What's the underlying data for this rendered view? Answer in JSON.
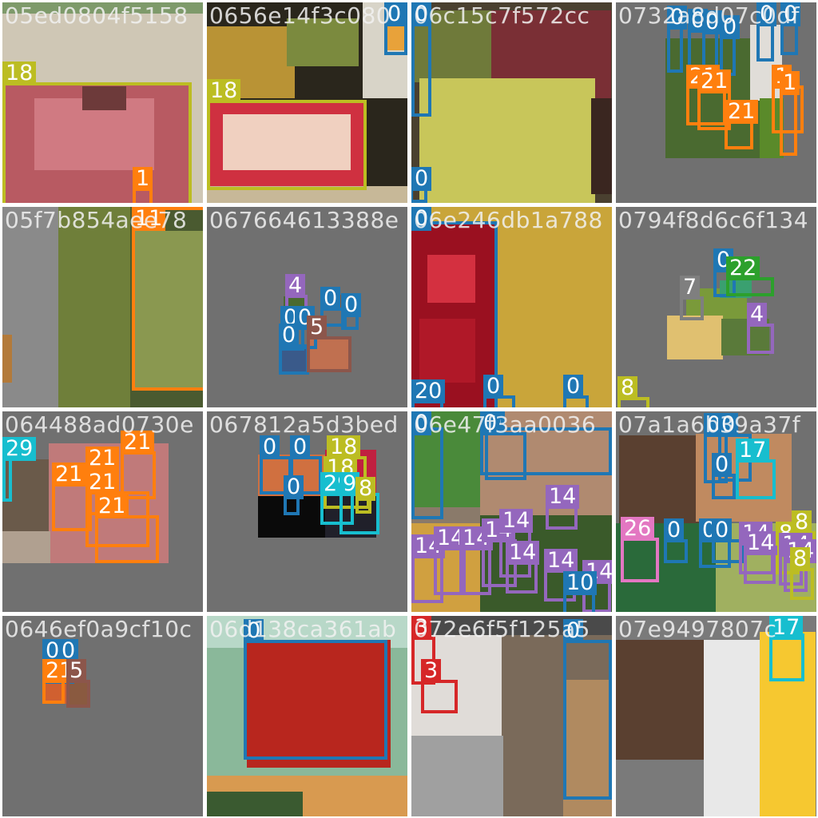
{
  "palette": {
    "0": "#1f77b4",
    "1": "#ff7f0e",
    "3": "#d62728",
    "4": "#9467bd",
    "5": "#8c564b",
    "7": "#7f7f7f",
    "8": "#bcbd22",
    "9": "#17becf",
    "10": "#1f77b4",
    "11": "#ff7f0e",
    "14": "#9467bd",
    "17": "#17becf",
    "18": "#bcbd22",
    "20": "#1f77b4",
    "21": "#ff7f0e",
    "22": "#2ca02c",
    "26": "#e377c2",
    "29": "#17becf"
  },
  "tiles": [
    {
      "id": "05ed0804f5158",
      "pieces": [
        [
          "#cfc7b5",
          0,
          0,
          251,
          251
        ],
        [
          "#7e9a6a",
          0,
          0,
          251,
          14
        ],
        [
          "#b85a62",
          0,
          102,
          235,
          149
        ],
        [
          "#d07a82",
          40,
          120,
          150,
          90
        ],
        [
          "#6d3a3a",
          100,
          105,
          55,
          30
        ]
      ],
      "boxes": [
        [
          0,
          100,
          237,
          155,
          "18"
        ],
        [
          163,
          232,
          25,
          25,
          "1"
        ]
      ]
    },
    {
      "id": "0656e14f3c080",
      "pieces": [
        [
          "#2a261c",
          0,
          0,
          251,
          251
        ],
        [
          "#b99335",
          0,
          30,
          110,
          90
        ],
        [
          "#7b8a3e",
          100,
          20,
          90,
          60
        ],
        [
          "#d8d4c8",
          195,
          0,
          56,
          120
        ],
        [
          "#e8a23a",
          225,
          30,
          22,
          30
        ],
        [
          "#cf3040",
          0,
          122,
          200,
          110
        ],
        [
          "#f0d0c0",
          20,
          140,
          160,
          70
        ],
        [
          "#c7b898",
          0,
          230,
          251,
          21
        ]
      ],
      "boxes": [
        [
          0,
          122,
          200,
          113,
          "18"
        ],
        [
          222,
          0,
          29,
          66,
          "0"
        ]
      ]
    },
    {
      "id": "06c15c7f572cc",
      "pieces": [
        [
          "#4a4030",
          0,
          0,
          251,
          251
        ],
        [
          "#7a2f35",
          100,
          10,
          150,
          120
        ],
        [
          "#6f7a3a",
          0,
          10,
          100,
          90
        ],
        [
          "#c8c65a",
          10,
          95,
          220,
          156
        ],
        [
          "#3a2620",
          225,
          120,
          26,
          120
        ]
      ],
      "boxes": [
        [
          0,
          0,
          25,
          143,
          "0"
        ],
        [
          -2,
          232,
          22,
          19,
          "0"
        ]
      ]
    },
    {
      "id": "0732a8d07c0df",
      "pieces": [
        [
          "#707070",
          0,
          0,
          251,
          251
        ],
        [
          "#4a6a30",
          62,
          45,
          135,
          150
        ],
        [
          "#e0ddd8",
          168,
          28,
          40,
          95
        ],
        [
          "#5a8a2a",
          180,
          120,
          30,
          75
        ]
      ],
      "boxes": [
        [
          64,
          30,
          20,
          58,
          "0"
        ],
        [
          90,
          34,
          22,
          55,
          "0"
        ],
        [
          108,
          36,
          20,
          50,
          "0"
        ],
        [
          130,
          42,
          20,
          50,
          "0"
        ],
        [
          176,
          26,
          22,
          48,
          "0"
        ],
        [
          206,
          26,
          22,
          40,
          "0"
        ],
        [
          88,
          104,
          50,
          50,
          "21"
        ],
        [
          102,
          110,
          42,
          50,
          "21"
        ],
        [
          136,
          148,
          36,
          36,
          "21"
        ],
        [
          195,
          104,
          40,
          60,
          "1"
        ],
        [
          205,
          112,
          22,
          80,
          "1"
        ]
      ]
    },
    {
      "id": "05f7b854aee78",
      "pieces": [
        [
          "#4a5a30",
          0,
          0,
          251,
          251
        ],
        [
          "#8a8a8a",
          0,
          0,
          75,
          251
        ],
        [
          "#6f7f3a",
          70,
          0,
          90,
          251
        ],
        [
          "#8a9850",
          162,
          30,
          89,
          200
        ],
        [
          "#b37a3a",
          0,
          160,
          12,
          60
        ]
      ],
      "boxes": [
        [
          162,
          0,
          93,
          230,
          "11"
        ]
      ]
    },
    {
      "id": "067664613388e",
      "pieces": [
        [
          "#707070",
          0,
          0,
          251,
          251
        ],
        [
          "#4a6a30",
          96,
          112,
          30,
          32
        ],
        [
          "#c07050",
          125,
          162,
          56,
          45
        ],
        [
          "#3a5a8a",
          90,
          172,
          38,
          38
        ],
        [
          "#8a5a3a",
          142,
          110,
          30,
          20
        ]
      ],
      "boxes": [
        [
          98,
          110,
          28,
          34,
          "4"
        ],
        [
          142,
          126,
          33,
          24,
          "0"
        ],
        [
          168,
          134,
          22,
          20,
          "0"
        ],
        [
          92,
          150,
          30,
          30,
          "0"
        ],
        [
          110,
          150,
          28,
          28,
          "0"
        ],
        [
          90,
          172,
          38,
          38,
          "0"
        ],
        [
          125,
          162,
          56,
          45,
          "5"
        ]
      ]
    },
    {
      "id": "06e246db1a788",
      "pieces": [
        [
          "#c9a53a",
          0,
          0,
          251,
          251
        ],
        [
          "#9a1020",
          0,
          20,
          108,
          231
        ],
        [
          "#d43040",
          20,
          60,
          60,
          60
        ],
        [
          "#b01828",
          10,
          140,
          70,
          80
        ]
      ],
      "boxes": [
        [
          -4,
          18,
          112,
          240,
          "0"
        ],
        [
          90,
          236,
          40,
          20,
          "0"
        ],
        [
          190,
          236,
          32,
          20,
          "0"
        ],
        [
          0,
          242,
          40,
          20,
          "20"
        ]
      ]
    },
    {
      "id": "0794f8d6c6f134",
      "pieces": [
        [
          "#707070",
          0,
          0,
          251,
          251
        ],
        [
          "#7a9a3a",
          88,
          102,
          76,
          50
        ],
        [
          "#e0c070",
          64,
          136,
          70,
          55
        ],
        [
          "#5a7a3a",
          132,
          140,
          60,
          46
        ],
        [
          "#3aa070",
          130,
          92,
          40,
          22
        ]
      ],
      "boxes": [
        [
          122,
          78,
          28,
          35,
          "0"
        ],
        [
          138,
          88,
          60,
          24,
          "22"
        ],
        [
          80,
          112,
          30,
          30,
          "7"
        ],
        [
          164,
          146,
          34,
          38,
          "4"
        ],
        [
          2,
          238,
          40,
          30,
          "8"
        ]
      ]
    },
    {
      "id": "064488ad0730e",
      "pieces": [
        [
          "#707070",
          0,
          0,
          251,
          251
        ],
        [
          "#6a5a4a",
          0,
          60,
          60,
          130
        ],
        [
          "#c07a7a",
          58,
          40,
          150,
          150
        ],
        [
          "#b0a090",
          0,
          150,
          60,
          40
        ]
      ],
      "boxes": [
        [
          0,
          58,
          12,
          55,
          "29"
        ],
        [
          62,
          90,
          50,
          60,
          "21"
        ],
        [
          104,
          70,
          42,
          60,
          "21"
        ],
        [
          148,
          50,
          44,
          60,
          "21"
        ],
        [
          104,
          100,
          80,
          70,
          "21"
        ],
        [
          116,
          130,
          80,
          60,
          "21"
        ]
      ]
    },
    {
      "id": "067812a5d3bed",
      "pieces": [
        [
          "#707070",
          0,
          0,
          251,
          251
        ],
        [
          "#d07040",
          64,
          54,
          84,
          52
        ],
        [
          "#0a0a0a",
          64,
          106,
          84,
          52
        ],
        [
          "#c02040",
          148,
          48,
          64,
          58
        ],
        [
          "#20202a",
          148,
          106,
          64,
          52
        ]
      ],
      "boxes": [
        [
          66,
          56,
          40,
          48,
          "0"
        ],
        [
          104,
          56,
          40,
          48,
          "0"
        ],
        [
          150,
          56,
          50,
          50,
          "18"
        ],
        [
          146,
          82,
          58,
          40,
          "18"
        ],
        [
          142,
          102,
          42,
          40,
          "29"
        ],
        [
          166,
          102,
          50,
          52,
          "9"
        ],
        [
          186,
          108,
          20,
          20,
          "8"
        ],
        [
          96,
          106,
          20,
          24,
          "0"
        ]
      ]
    },
    {
      "id": "06e47f3aa0036",
      "pieces": [
        [
          "#8a7a6a",
          0,
          0,
          251,
          251
        ],
        [
          "#4a8a3a",
          0,
          0,
          86,
          120
        ],
        [
          "#b08a70",
          86,
          0,
          165,
          140
        ],
        [
          "#3a5a2a",
          86,
          130,
          165,
          121
        ],
        [
          "#d0a040",
          0,
          140,
          86,
          111
        ]
      ],
      "boxes": [
        [
          0,
          20,
          40,
          115,
          "0"
        ],
        [
          92,
          26,
          52,
          60,
          "0"
        ],
        [
          86,
          20,
          165,
          60,
          "0"
        ],
        [
          168,
          118,
          40,
          30,
          "14"
        ],
        [
          0,
          180,
          40,
          60,
          "14"
        ],
        [
          28,
          170,
          40,
          60,
          "14"
        ],
        [
          60,
          170,
          40,
          60,
          "14"
        ],
        [
          88,
          160,
          44,
          60,
          "14"
        ],
        [
          110,
          148,
          40,
          60,
          "14"
        ],
        [
          118,
          188,
          40,
          40,
          "14"
        ],
        [
          166,
          198,
          40,
          40,
          "14"
        ],
        [
          214,
          212,
          36,
          40,
          "14"
        ],
        [
          190,
          226,
          40,
          30,
          "10"
        ]
      ]
    },
    {
      "id": "07a1a6b39a37f",
      "pieces": [
        [
          "#707070",
          0,
          0,
          251,
          251
        ],
        [
          "#5a4030",
          4,
          30,
          100,
          110
        ],
        [
          "#c08a60",
          100,
          28,
          120,
          110
        ],
        [
          "#2a6a3a",
          0,
          140,
          125,
          111
        ],
        [
          "#a0b060",
          125,
          140,
          126,
          111
        ]
      ],
      "boxes": [
        [
          110,
          28,
          30,
          62,
          "0"
        ],
        [
          128,
          28,
          42,
          60,
          "0"
        ],
        [
          150,
          60,
          50,
          50,
          "17"
        ],
        [
          120,
          78,
          30,
          32,
          "0"
        ],
        [
          6,
          158,
          48,
          56,
          "26"
        ],
        [
          60,
          160,
          30,
          30,
          "0"
        ],
        [
          104,
          160,
          40,
          36,
          "0"
        ],
        [
          120,
          160,
          40,
          30,
          "0"
        ],
        [
          154,
          164,
          44,
          40,
          "14"
        ],
        [
          160,
          176,
          40,
          40,
          "14"
        ],
        [
          200,
          164,
          30,
          40,
          "8"
        ],
        [
          220,
          150,
          30,
          40,
          "8"
        ],
        [
          204,
          178,
          30,
          40,
          "14"
        ],
        [
          210,
          186,
          30,
          40,
          "14"
        ],
        [
          218,
          196,
          30,
          40,
          "8"
        ]
      ]
    },
    {
      "id": "0646ef0a9cf10c",
      "pieces": [
        [
          "#707070",
          0,
          0,
          251,
          251
        ],
        [
          "#3a4a6a",
          50,
          55,
          30,
          30
        ],
        [
          "#d06030",
          50,
          80,
          30,
          30
        ],
        [
          "#8a5a40",
          80,
          80,
          30,
          35
        ]
      ],
      "boxes": [
        [
          50,
          55,
          20,
          30,
          "0"
        ],
        [
          70,
          55,
          20,
          30,
          "0"
        ],
        [
          50,
          80,
          28,
          30,
          "21"
        ],
        [
          80,
          80,
          30,
          35,
          "5"
        ]
      ]
    },
    {
      "id": "06d138ca361ab",
      "pieces": [
        [
          "#8ab89a",
          0,
          0,
          251,
          251
        ],
        [
          "#b8d8c8",
          0,
          0,
          251,
          40
        ],
        [
          "#b8261e",
          50,
          30,
          180,
          160
        ],
        [
          "#d89a50",
          0,
          200,
          251,
          51
        ],
        [
          "#3a5a30",
          0,
          220,
          120,
          31
        ]
      ],
      "boxes": [
        [
          46,
          30,
          180,
          150,
          "0"
        ]
      ]
    },
    {
      "id": "072e6f5f125a5",
      "pieces": [
        [
          "#4a4a4a",
          0,
          0,
          251,
          251
        ],
        [
          "#e0dcd8",
          0,
          24,
          115,
          130
        ],
        [
          "#7a6a5a",
          113,
          24,
          138,
          227
        ],
        [
          "#b08a60",
          190,
          80,
          61,
          180
        ],
        [
          "#a0a0a0",
          0,
          150,
          115,
          101
        ]
      ],
      "boxes": [
        [
          0,
          26,
          30,
          60,
          "3"
        ],
        [
          12,
          80,
          46,
          42,
          "3"
        ],
        [
          190,
          30,
          61,
          200,
          "0"
        ]
      ]
    },
    {
      "id": "07e9497807c",
      "pieces": [
        [
          "#7a7a7a",
          0,
          0,
          251,
          251
        ],
        [
          "#e8e8e8",
          110,
          30,
          140,
          221
        ],
        [
          "#f6c830",
          180,
          20,
          70,
          231
        ],
        [
          "#5a4030",
          0,
          30,
          110,
          150
        ]
      ],
      "boxes": [
        [
          192,
          22,
          44,
          60,
          "17"
        ]
      ]
    }
  ]
}
